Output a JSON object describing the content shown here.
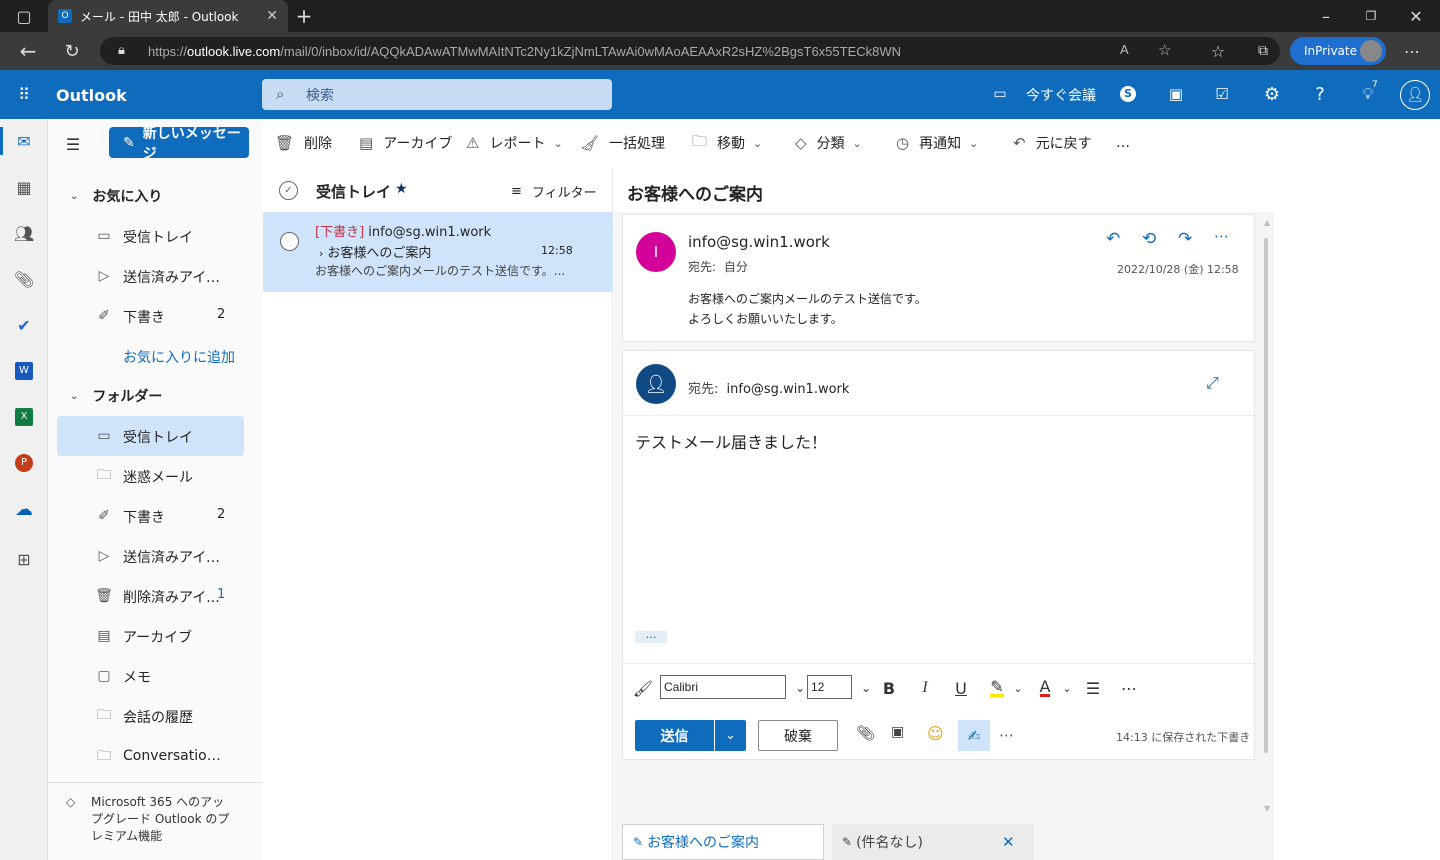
{
  "browser": {
    "tab_title": "メール - 田中 太郎 - Outlook",
    "url_prefix": "https://",
    "url_host": "outlook.live.com",
    "url_path": "/mail/0/inbox/id/AQQkADAwATMwMAItNTc2Ny1kZjNmLTAwAi0wMAoAEAAxR2sHZ%2BgsT6x55TECk8WN",
    "inprivate_label": "InPrivate"
  },
  "header": {
    "app_name": "Outlook",
    "search_placeholder": "検索",
    "meet_now_label": "今すぐ会議",
    "notification_count": "7"
  },
  "commandbar": {
    "new_message": "新しいメッセージ",
    "delete": "削除",
    "archive": "アーカイブ",
    "report": "レポート",
    "sweep": "一括処理",
    "move": "移動",
    "categorize": "分類",
    "snooze": "再通知",
    "undo": "元に戻す",
    "more": "…"
  },
  "folders": {
    "favorites_header": "お気に入り",
    "favorites": [
      {
        "label": "受信トレイ",
        "count": ""
      },
      {
        "label": "送信済みアイテム",
        "count": ""
      },
      {
        "label": "下書き",
        "count": "2"
      }
    ],
    "add_favorite": "お気に入りに追加",
    "folders_header": "フォルダー",
    "items": [
      {
        "label": "受信トレイ",
        "count": ""
      },
      {
        "label": "迷惑メール",
        "count": ""
      },
      {
        "label": "下書き",
        "count": "2"
      },
      {
        "label": "送信済みアイテム",
        "count": ""
      },
      {
        "label": "削除済みアイ...",
        "count": "1"
      },
      {
        "label": "アーカイブ",
        "count": ""
      },
      {
        "label": "メモ",
        "count": ""
      },
      {
        "label": "会話の履歴",
        "count": ""
      },
      {
        "label": "Conversation ...",
        "count": ""
      }
    ],
    "upgrade_text": "Microsoft 365 へのアップグレード Outlook のプレミアム機能"
  },
  "message_list": {
    "title": "受信トレイ",
    "filter_label": "フィルター",
    "messages": [
      {
        "draft_tag": "[下書き]",
        "sender": "info@sg.win1.work",
        "subject": "お客様へのご案内",
        "time": "12:58",
        "preview": "お客様へのご案内メールのテスト送信です。..."
      }
    ]
  },
  "reading": {
    "subject": "お客様へのご案内",
    "avatar_letter": "I",
    "avatar_color": "#d4009a",
    "from": "info@sg.win1.work",
    "to_label": "宛先:",
    "to_value": "自分",
    "datetime": "2022/10/28 (金) 12:58",
    "body_line1": "お客様へのご案内メールのテスト送信です。",
    "body_line2": "よろしくお願いいたします。"
  },
  "compose": {
    "to_label": "宛先:",
    "to_value": "info@sg.win1.work",
    "body": "テストメール届きました！",
    "ellipsis": "…",
    "font_name": "Calibri",
    "font_size": "12",
    "send_label": "送信",
    "discard_label": "破棄",
    "saved_status": "14:13 に保存された下書き"
  },
  "bottom_tabs": [
    {
      "label": "お客様へのご案内"
    },
    {
      "label": "(件名なし)"
    }
  ],
  "colors": {
    "brand": "#0f6cbd",
    "selected": "#cfe4fa",
    "draft_red": "#c4314b"
  }
}
